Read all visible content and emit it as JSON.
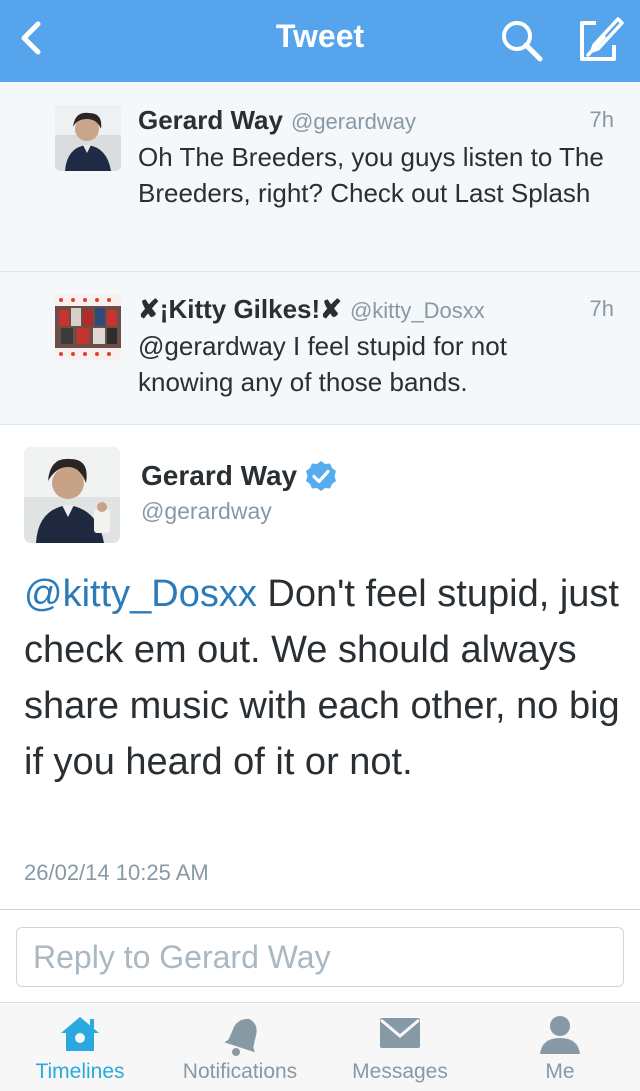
{
  "header": {
    "title": "Tweet",
    "icons": [
      "back-chevron-icon",
      "search-icon",
      "compose-icon"
    ],
    "background": "#56a5ec"
  },
  "conversation": [
    {
      "name": "Gerard Way",
      "handle": "@gerardway",
      "time": "7h",
      "text": "Oh The Breeders, you guys listen to The Breeders, right? Check out Last Splash"
    },
    {
      "name": "✘¡Kitty Gilkes!✘",
      "handle": "@kitty_Dosxx",
      "time": "7h",
      "text": "@gerardway I feel stupid for not knowing any of those bands."
    }
  ],
  "main_tweet": {
    "name": "Gerard Way",
    "handle": "@gerardway",
    "mention": "@kitty_Dosxx",
    "text": " Don't feel stupid, just check em out. We should always share music with each other, no big if you heard of it or not.",
    "date": "26/02/14 10:25 AM",
    "verified_color": "#55acee",
    "mention_color": "#2b7bb9"
  },
  "reply": {
    "placeholder": "Reply to Gerard Way"
  },
  "tabbar": {
    "items": [
      {
        "label": "Timelines",
        "icon": "home-icon",
        "active": true
      },
      {
        "label": "Notifications",
        "icon": "bell-icon",
        "active": false
      },
      {
        "label": "Messages",
        "icon": "envelope-icon",
        "active": false
      },
      {
        "label": "Me",
        "icon": "person-icon",
        "active": false
      }
    ],
    "active_color": "#2aa9e0",
    "inactive_color": "#8899a6"
  }
}
